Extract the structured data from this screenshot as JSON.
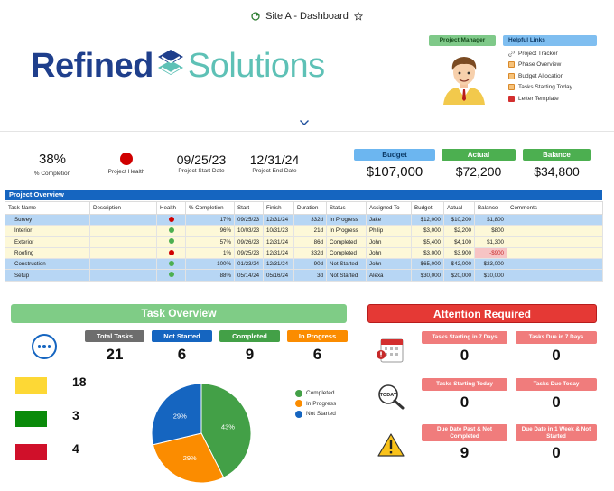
{
  "topbar": {
    "title": "Site A - Dashboard"
  },
  "logo": {
    "word1": "Refined",
    "word2": "Solutions"
  },
  "project_manager": {
    "label": "Project Manager"
  },
  "helpful_links": {
    "label": "Helpful Links",
    "items": [
      {
        "label": "Project Tracker",
        "icon": "link-icon",
        "color": "#888888"
      },
      {
        "label": "Phase Overview",
        "icon": "sheet-icon",
        "color": "#e8a040"
      },
      {
        "label": "Budget Allocation",
        "icon": "sheet-icon",
        "color": "#e8a040"
      },
      {
        "label": "Tasks Starting Today",
        "icon": "sheet-icon",
        "color": "#e8a040"
      },
      {
        "label": "Letter Template",
        "icon": "pdf-icon",
        "color": "#d32f2f"
      }
    ]
  },
  "kpis": {
    "completion": {
      "value": "38%",
      "label": "% Completion"
    },
    "health": {
      "label": "Project Health",
      "color": "#d00000"
    },
    "start": {
      "value": "09/25/23",
      "label": "Project Start Date"
    },
    "end": {
      "value": "12/31/24",
      "label": "Project End Date"
    }
  },
  "finance": {
    "budget": {
      "label": "Budget",
      "value": "$107,000",
      "color": "#6cb6f0"
    },
    "actual": {
      "label": "Actual",
      "value": "$72,200",
      "color": "#4caf50"
    },
    "balance": {
      "label": "Balance",
      "value": "$34,800",
      "color": "#4caf50"
    }
  },
  "project_overview": {
    "title": "Project Overview",
    "columns": [
      "Task Name",
      "Description",
      "Health",
      "% Completion",
      "Start",
      "Finish",
      "Duration",
      "Status",
      "Assigned To",
      "Budget",
      "Actual",
      "Balance",
      "Comments"
    ],
    "rows": [
      {
        "type": "parent",
        "task": "Survey",
        "desc": "",
        "health": "#d00000",
        "pct": "17%",
        "start": "09/25/23",
        "finish": "12/31/24",
        "duration": "332d",
        "status": "In Progress",
        "assigned": "Jake",
        "budget": "$12,000",
        "actual": "$10,200",
        "balance": "$1,800",
        "neg": false,
        "comments": ""
      },
      {
        "type": "sub",
        "task": "Interior",
        "desc": "",
        "health": "#4caf50",
        "pct": "96%",
        "start": "10/03/23",
        "finish": "10/31/23",
        "duration": "21d",
        "status": "In Progress",
        "assigned": "Philip",
        "budget": "$3,000",
        "actual": "$2,200",
        "balance": "$800",
        "neg": false,
        "comments": ""
      },
      {
        "type": "sub",
        "task": "Exterior",
        "desc": "",
        "health": "#4caf50",
        "pct": "57%",
        "start": "09/26/23",
        "finish": "12/31/24",
        "duration": "86d",
        "status": "Completed",
        "assigned": "John",
        "budget": "$5,400",
        "actual": "$4,100",
        "balance": "$1,300",
        "neg": false,
        "comments": ""
      },
      {
        "type": "sub",
        "task": "Roofing",
        "desc": "",
        "health": "#d00000",
        "pct": "1%",
        "start": "09/25/23",
        "finish": "12/31/24",
        "duration": "332d",
        "status": "Completed",
        "assigned": "John",
        "budget": "$3,000",
        "actual": "$3,900",
        "balance": "-$900",
        "neg": true,
        "comments": ""
      },
      {
        "type": "parent",
        "task": "Construction",
        "desc": "",
        "health": "#4caf50",
        "pct": "100%",
        "start": "01/23/24",
        "finish": "12/31/24",
        "duration": "90d",
        "status": "Not Started",
        "assigned": "John",
        "budget": "$65,000",
        "actual": "$42,000",
        "balance": "$23,000",
        "neg": false,
        "comments": ""
      },
      {
        "type": "parent",
        "task": "Setup",
        "desc": "",
        "health": "#4caf50",
        "pct": "88%",
        "start": "05/14/24",
        "finish": "05/16/24",
        "duration": "3d",
        "status": "Not Started",
        "assigned": "Alexa",
        "budget": "$30,000",
        "actual": "$20,000",
        "balance": "$10,000",
        "neg": false,
        "comments": ""
      }
    ]
  },
  "task_overview": {
    "title": "Task Overview",
    "stats": [
      {
        "label": "Total Tasks",
        "value": "21",
        "color": "#6d6d6d"
      },
      {
        "label": "Not Started",
        "value": "6",
        "color": "#1565c0"
      },
      {
        "label": "Completed",
        "value": "9",
        "color": "#43a047"
      },
      {
        "label": "In Progress",
        "value": "6",
        "color": "#fb8c00"
      }
    ],
    "legend": [
      {
        "value": "18",
        "color": "#fdd835"
      },
      {
        "value": "3",
        "color": "#0a8a0a"
      },
      {
        "value": "4",
        "color": "#d0102a"
      }
    ]
  },
  "chart_data": {
    "type": "pie",
    "categories": [
      "Completed",
      "In Progress",
      "Not Started"
    ],
    "values": [
      43,
      29,
      29
    ],
    "data_labels": [
      "43%",
      "29%",
      "29%"
    ],
    "colors": [
      "#43a047",
      "#fb8c00",
      "#1565c0"
    ],
    "legend": "right"
  },
  "attention": {
    "title": "Attention Required",
    "items": [
      {
        "label": "Tasks Starting in 7 Days",
        "value": "0"
      },
      {
        "label": "Tasks Due in 7 Days",
        "value": "0"
      },
      {
        "label": "Tasks Starting Today",
        "value": "0"
      },
      {
        "label": "Tasks Due Today",
        "value": "0"
      },
      {
        "label": "Due Date Past & Not Completed",
        "value": "9"
      },
      {
        "label": "Due Date in 1 Week & Not Started",
        "value": "0"
      }
    ]
  }
}
